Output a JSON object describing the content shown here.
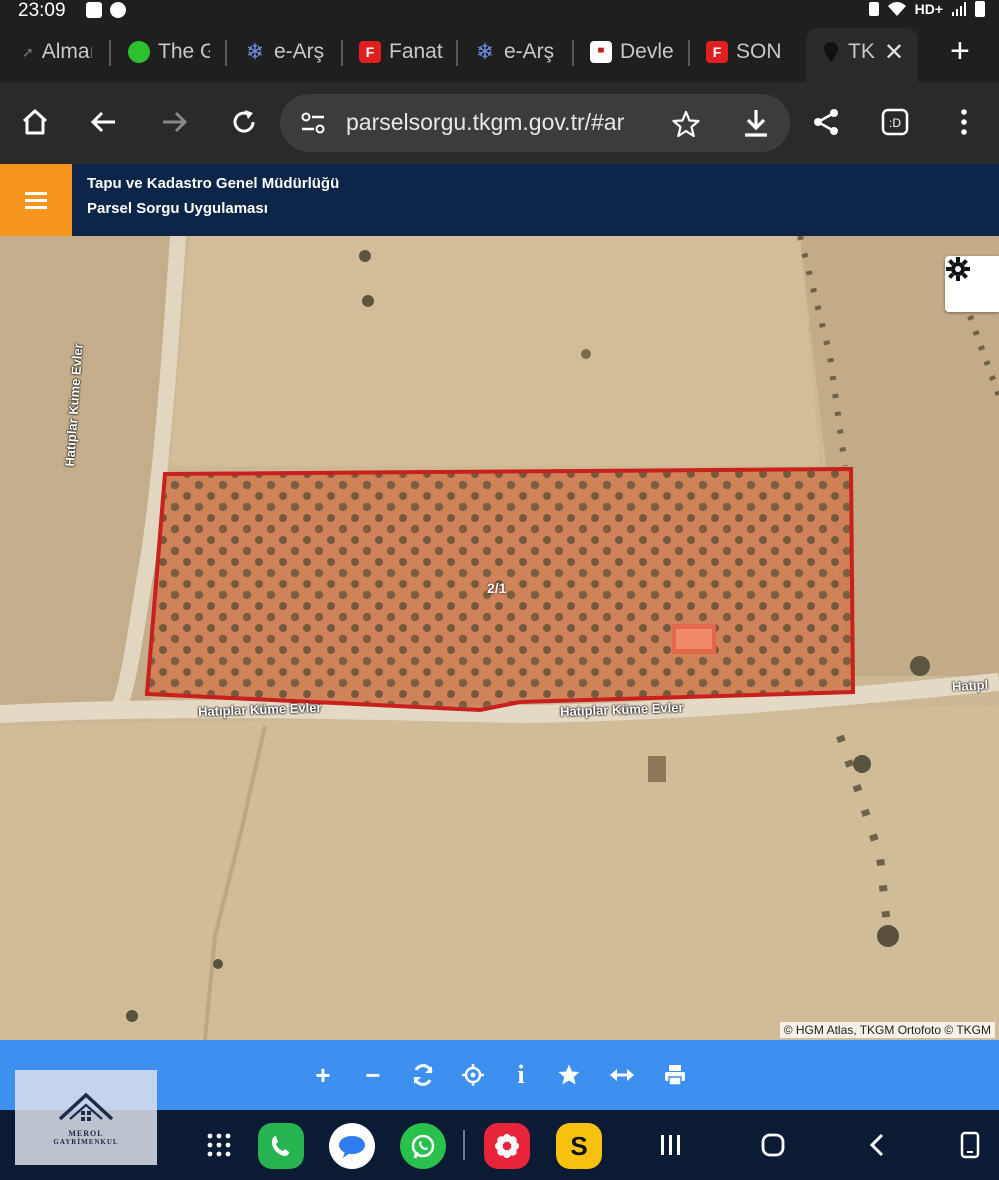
{
  "status": {
    "time": "23:09",
    "network": "HD+"
  },
  "tabs": [
    {
      "label": "Almaı",
      "fav_color": "#3a3a3a",
      "fav_text": ""
    },
    {
      "label": "The G",
      "fav_color": "#2ec12e",
      "fav_text": ""
    },
    {
      "label": "e-Arş",
      "fav_color": "#4c6fd8",
      "fav_text": ""
    },
    {
      "label": "Fanat",
      "fav_color": "#e02020",
      "fav_text": "F"
    },
    {
      "label": "e-Arş",
      "fav_color": "#4c6fd8",
      "fav_text": ""
    },
    {
      "label": "Devle",
      "fav_color": "#c01c1c",
      "fav_text": ""
    },
    {
      "label": "SON",
      "fav_color": "#e02020",
      "fav_text": "F"
    },
    {
      "label": "TK",
      "fav_color": "#2a2a2a",
      "fav_text": ""
    }
  ],
  "toolbar": {
    "url": "parselsorgu.tkgm.gov.tr/#ar"
  },
  "app": {
    "title1": "Tapu ve Kadastro Genel Müdürlüğü",
    "title2": "Parsel Sorgu Uygulaması",
    "accent": "#f7961e",
    "header_bg": "#0d2548"
  },
  "map": {
    "parcel_label": "2/1",
    "road_label_1": "Hatıplar Küme Evler",
    "road_label_2": "Hatıplar Küme Evler",
    "road_label_3": "Hatıplar Küme Evler",
    "road_label_4": "Hatıpl",
    "attribution": "© HGM Atlas, TKGM Ortofoto © TKGM",
    "parcel_color": "#c8201c"
  },
  "map_tools": [
    "zoom-in",
    "zoom-out",
    "refresh",
    "locate",
    "info",
    "favorite",
    "measure",
    "print"
  ],
  "logo": {
    "line1": "MEROL",
    "line2": "GAYRİMENKUL"
  }
}
